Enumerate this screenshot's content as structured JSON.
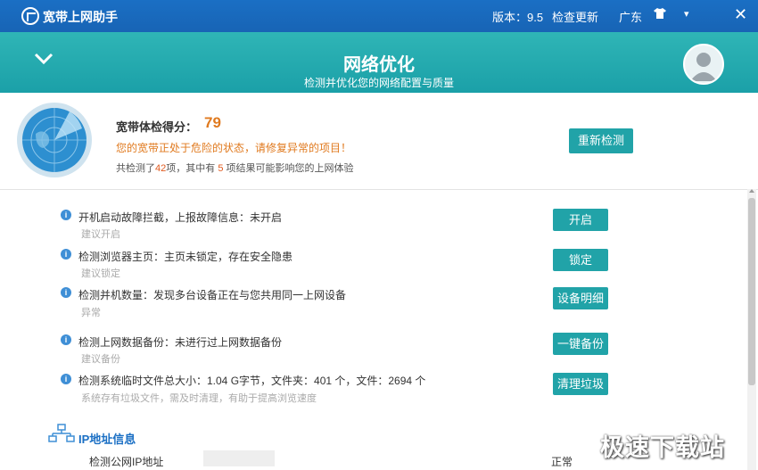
{
  "titlebar": {
    "app_title": "宽带上网助手",
    "version": "版本：9.5",
    "check_update": "检查更新",
    "region": "广东",
    "skin_icon": "tshirt-icon",
    "menu_icon": "▾",
    "close_icon": "✕"
  },
  "header": {
    "title": "网络优化",
    "subtitle": "检测并优化您的网络配置与质量",
    "background": "#2fb5b6"
  },
  "score": {
    "label": "宽带体检得分：",
    "value": "79",
    "warning": "您的宽带正处于危险的状态，请修复异常的项目！",
    "summary_prefix": "共检测了",
    "total": "42",
    "summary_mid": "项，其中有",
    "issues": "5",
    "summary_suffix": "项结果可能影响您的上网体验",
    "recheck_button": "重新检测"
  },
  "items": [
    {
      "title": "开机启动故障拦截，上报故障信息：未开启",
      "hint": "建议开启",
      "button": "开启"
    },
    {
      "title": "检测浏览器主页：主页未锁定，存在安全隐患",
      "hint": "建议锁定",
      "button": "锁定"
    },
    {
      "title": "检测并机数量：发现多台设备正在与您共用同一上网设备",
      "hint": "异常",
      "button": "设备明细"
    },
    {
      "title": "检测上网数据备份：未进行过上网数据备份",
      "hint": "建议备份",
      "button": "一键备份"
    },
    {
      "title": "检测系统临时文件总大小：1.04 G字节，文件夹：401 个，文件：2694 个",
      "hint": "系统存有垃圾文件，需及时清理，有助于提高浏览速度",
      "button": "清理垃圾"
    }
  ],
  "ip_section": {
    "title": "IP地址信息",
    "row_label": "检测公网IP地址",
    "row_status": "正常"
  },
  "watermark": "极速下载站",
  "colors": {
    "titlebar": "#1a6fc4",
    "accent": "#21a3a8",
    "warning": "#e07a1f",
    "info_icon": "#3f8fd6"
  }
}
